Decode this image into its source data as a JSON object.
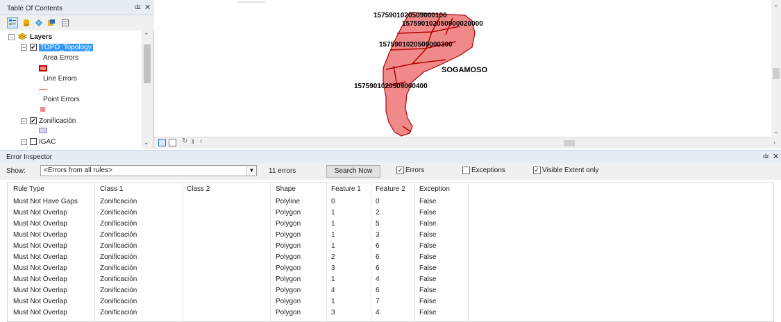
{
  "toc": {
    "title": "Table Of Contents",
    "pin": " p",
    "close": "×",
    "layers_label": "Layers",
    "topology_label": "TOPO_Topology",
    "area_errors": "Area Errors",
    "line_errors": "Line Errors",
    "point_errors": "Point Errors",
    "zonificacion_label": "Zonificación",
    "igac_label": "IGAC"
  },
  "map": {
    "labels": [
      "1575901020509000100",
      "157590102050900020000",
      "1575901020509000300",
      "SOGAMOSO",
      "1575901020509000400"
    ],
    "feature_color": "#f08a8a",
    "outline_color": "#b00000"
  },
  "error_inspector": {
    "title": "Error Inspector",
    "show_label": "Show:",
    "show_value": "<Errors from all rules>",
    "error_count": "11 errors",
    "search_button": "Search Now",
    "errors_checkbox": "Errors",
    "exceptions_checkbox": "Exceptions",
    "visible_extent_checkbox": "Visible Extent only",
    "columns": [
      "Rule Type",
      "Class 1",
      "Class 2",
      "Shape",
      "Feature 1",
      "Feature 2",
      "Exception"
    ],
    "rows": [
      [
        "Must Not Have Gaps",
        "Zonificación",
        "",
        "Polyline",
        "0",
        "0",
        "False"
      ],
      [
        "Must Not Overlap",
        "Zonificación",
        "",
        "Polygon",
        "1",
        "2",
        "False"
      ],
      [
        "Must Not Overlap",
        "Zonificación",
        "",
        "Polygon",
        "1",
        "5",
        "False"
      ],
      [
        "Must Not Overlap",
        "Zonificación",
        "",
        "Polygon",
        "1",
        "3",
        "False"
      ],
      [
        "Must Not Overlap",
        "Zonificación",
        "",
        "Polygon",
        "1",
        "6",
        "False"
      ],
      [
        "Must Not Overlap",
        "Zonificación",
        "",
        "Polygon",
        "2",
        "6",
        "False"
      ],
      [
        "Must Not Overlap",
        "Zonificación",
        "",
        "Polygon",
        "3",
        "6",
        "False"
      ],
      [
        "Must Not Overlap",
        "Zonificación",
        "",
        "Polygon",
        "1",
        "4",
        "False"
      ],
      [
        "Must Not Overlap",
        "Zonificación",
        "",
        "Polygon",
        "4",
        "6",
        "False"
      ],
      [
        "Must Not Overlap",
        "Zonificación",
        "",
        "Polygon",
        "1",
        "7",
        "False"
      ],
      [
        "Must Not Overlap",
        "Zonificación",
        "",
        "Polygon",
        "3",
        "4",
        "False"
      ]
    ]
  }
}
